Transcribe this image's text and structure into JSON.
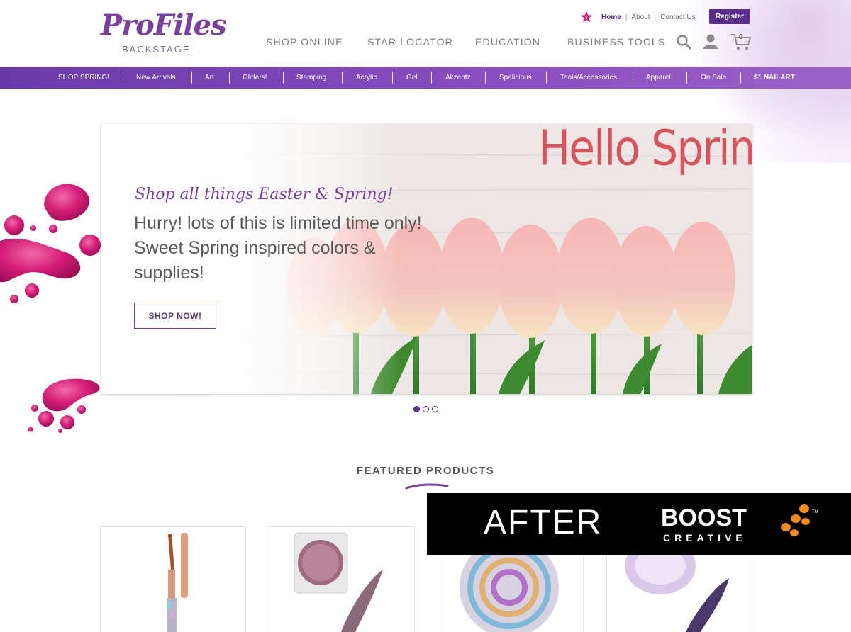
{
  "brand": {
    "logo_main": "ProFiles",
    "logo_sub": "BACKSTAGE"
  },
  "utility_nav": [
    {
      "label": "Home",
      "active": true
    },
    {
      "label": "About",
      "active": false
    },
    {
      "label": "Contact Us",
      "active": false
    }
  ],
  "register_label": "Register",
  "main_nav": [
    "SHOP ONLINE",
    "STAR LOCATOR",
    "EDUCATION",
    "BUSINESS TOOLS"
  ],
  "header_icons": [
    "search-icon",
    "account-icon",
    "cart-icon"
  ],
  "cart_count": "0",
  "categories": [
    "SHOP SPRING!",
    "New Arrivals",
    "Art",
    "Glitters!",
    "Stamping",
    "Acrylic",
    "Gel",
    "Akzentz",
    "Spalicious",
    "Tools/Accessories",
    "Apparel",
    "On Sale",
    "$1 NAILART"
  ],
  "hero": {
    "script_heading": "Shop all things Easter & Spring!",
    "body": "Hurry! lots of this is limited time only! Sweet Spring inspired colors & supplies!",
    "button_label": "SHOP NOW!",
    "image_headline": "Hello Spring",
    "slides_total": 3,
    "active_slide": 1
  },
  "featured": {
    "title": "FEATURED PRODUCTS"
  },
  "overlay_banner": {
    "label": "AFTER",
    "brand_main": "BOOST",
    "brand_sub": "CREATIVE",
    "trademark": "TM"
  },
  "colors": {
    "brand_purple": "#5b2d8e",
    "category_bar": "#7a45b5",
    "accent_pink": "#d81b7a",
    "hello_spring_red": "#d9535f",
    "boost_orange": "#f08a1e"
  }
}
